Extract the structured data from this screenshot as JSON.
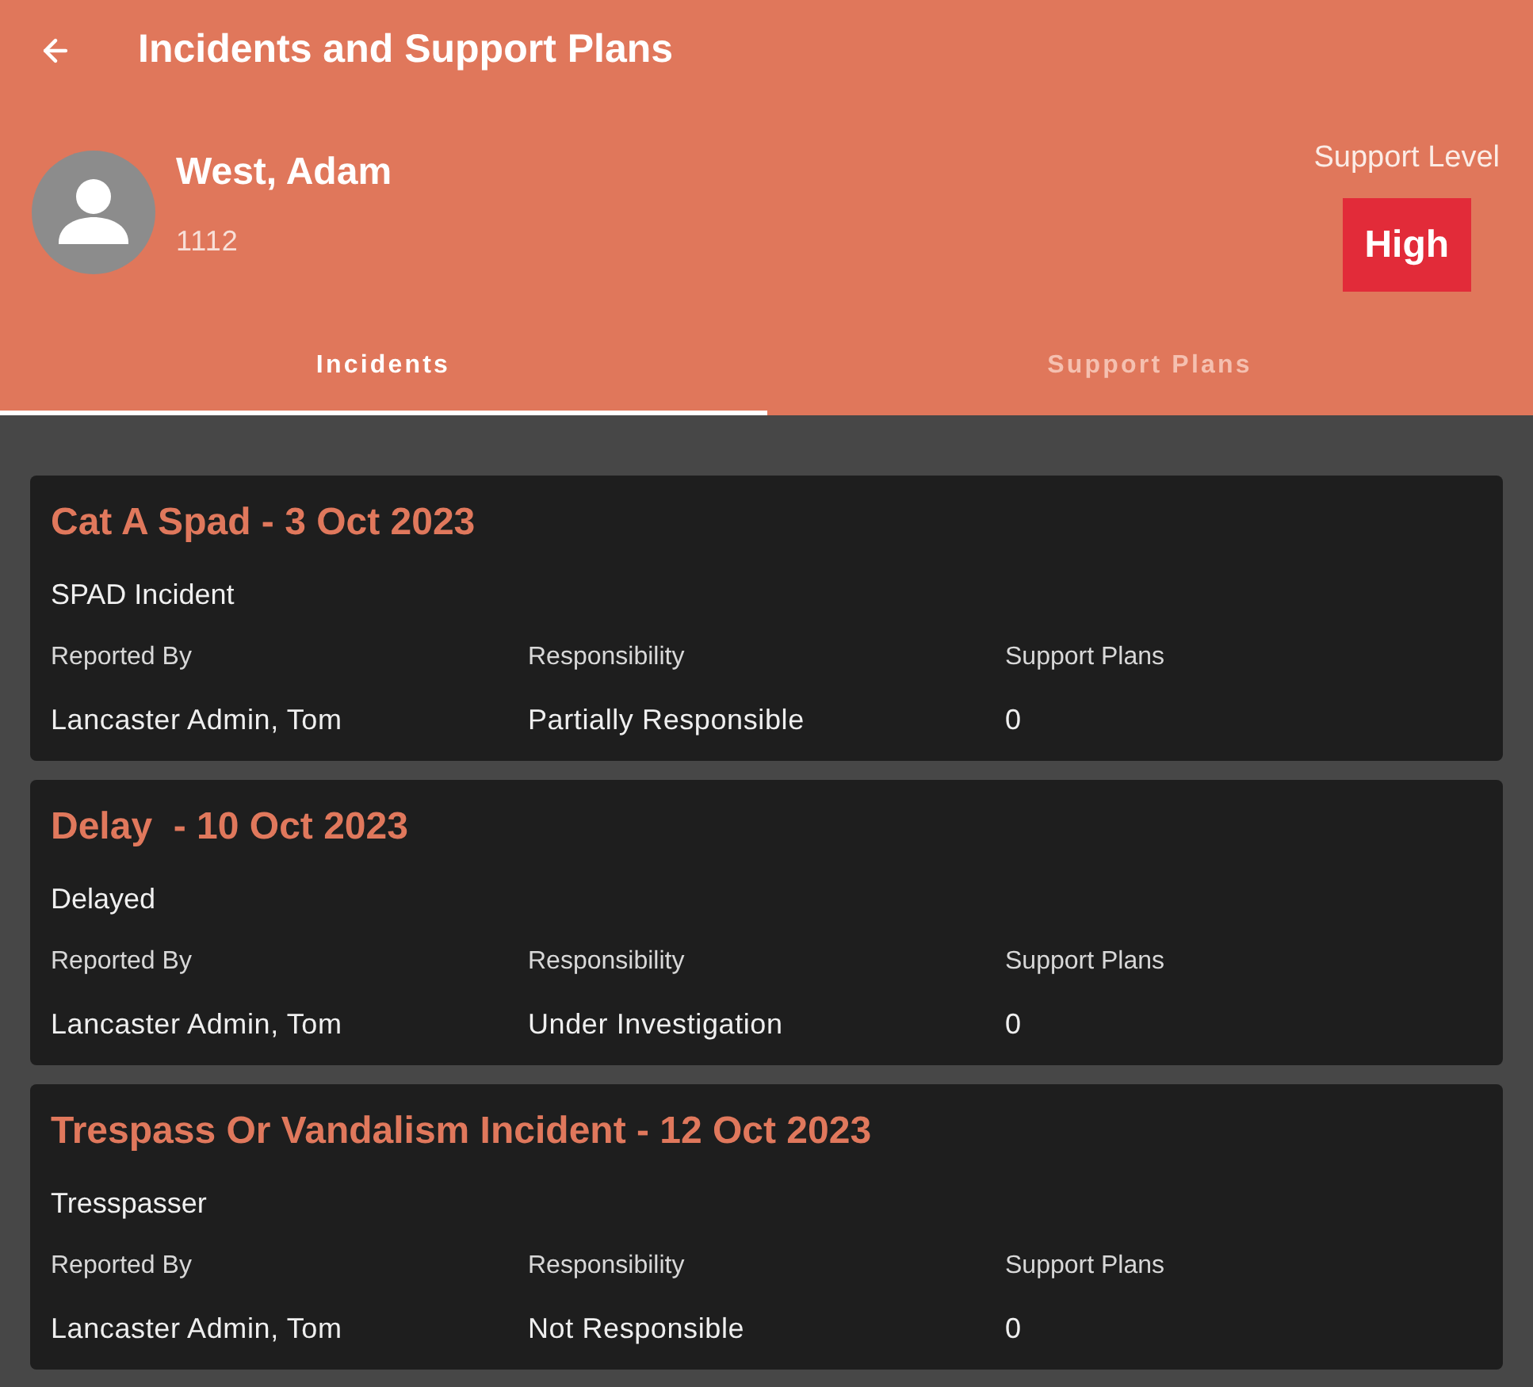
{
  "app_bar": {
    "title": "Incidents and Support Plans"
  },
  "profile": {
    "name": "West, Adam",
    "number": "1112",
    "support_level_label": "Support Level",
    "support_level": "High"
  },
  "tabs": [
    {
      "label": "Incidents",
      "selected": true
    },
    {
      "label": "Support Plans",
      "selected": false
    }
  ],
  "incidents": [
    {
      "title": "Cat A Spad - 3 Oct 2023",
      "category": "SPAD Incident",
      "fields": [
        {
          "label": "Reported By",
          "value": "Lancaster Admin, Tom"
        },
        {
          "label": "Responsibility",
          "value": "Partially Responsible"
        },
        {
          "label": "Support Plans",
          "value": "0"
        }
      ]
    },
    {
      "title": "Delay  - 10 Oct 2023",
      "category": "Delayed",
      "fields": [
        {
          "label": "Reported By",
          "value": "Lancaster Admin, Tom"
        },
        {
          "label": "Responsibility",
          "value": "Under Investigation"
        },
        {
          "label": "Support Plans",
          "value": "0"
        }
      ]
    },
    {
      "title": "Trespass Or Vandalism Incident - 12 Oct 2023",
      "category": "Tresspasser",
      "fields": [
        {
          "label": "Reported By",
          "value": "Lancaster Admin, Tom"
        },
        {
          "label": "Responsibility",
          "value": "Not Responsible"
        },
        {
          "label": "Support Plans",
          "value": "0"
        }
      ]
    }
  ]
}
